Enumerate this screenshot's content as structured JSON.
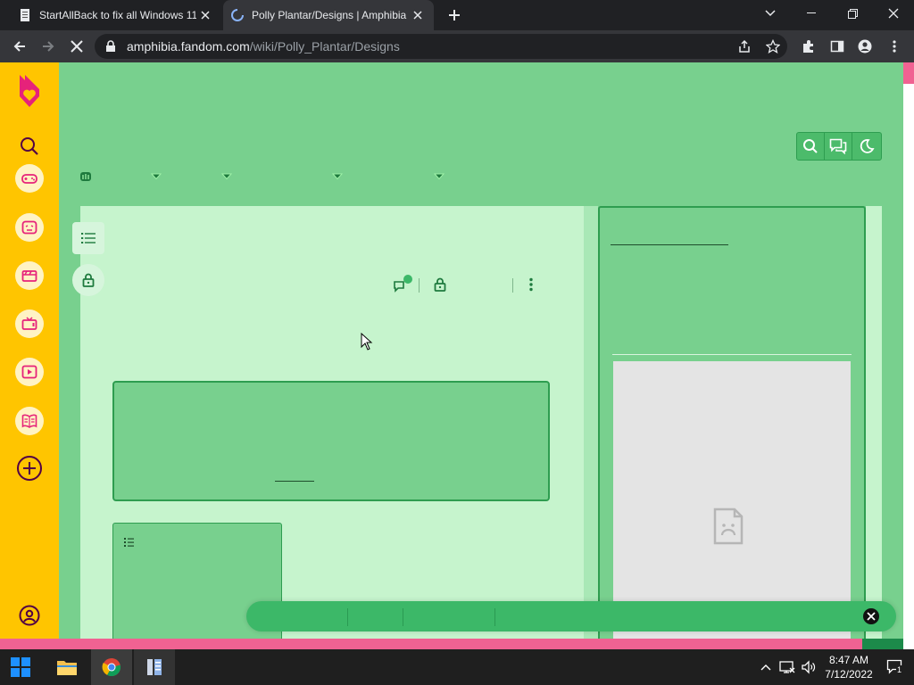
{
  "browser": {
    "tabs": [
      {
        "title": "StartAllBack to fix all Windows 11",
        "active": false
      },
      {
        "title": "Polly Plantar/Designs | Amphibia",
        "active": true,
        "loading": true
      }
    ],
    "url": {
      "host": "amphibia.fandom.com",
      "path": "/wiki/Polly_Plantar/Designs"
    }
  },
  "theme": {
    "page_bg": "#78d08e",
    "content_bg": "#c6f4cd",
    "accent": "#2e9d50",
    "fandom_rail": "#ffc500",
    "fandom_pink": "#f06292"
  },
  "fandom_rail": {
    "icons": [
      "fandom-logo-icon",
      "search-icon",
      "games-icon",
      "anime-icon",
      "movies-icon",
      "tv-icon",
      "video-icon",
      "book-icon",
      "create-wiki-icon",
      "user-icon"
    ]
  },
  "header_tools": [
    "search-icon",
    "discussions-icon",
    "dark-mode-icon"
  ],
  "taskbar": {
    "time": "8:47 AM",
    "date": "7/12/2022",
    "notification_count": "1"
  }
}
